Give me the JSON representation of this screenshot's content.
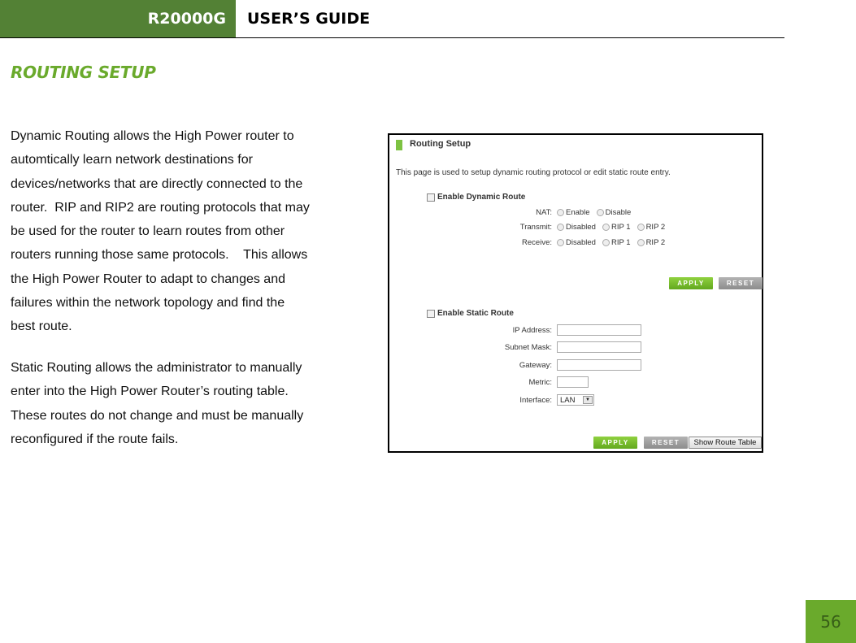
{
  "header": {
    "model": "R20000G",
    "guide": "USER’S GUIDE"
  },
  "section_title": "ROUTING SETUP",
  "paragraphs": {
    "dynamic": "Dynamic Routing allows the High Power router to\nautomtically learn network destinations for\ndevices/networks that are directly connected to the\nrouter.  RIP and RIP2 are routing protocols that may\nbe used for the router to learn routes from other\nrouters running those same protocols.    This allows\nthe High Power Router to adapt to changes and\nfailures within the network topology and find the\nbest route.",
    "static": "Static Routing allows the administrator to manually\nenter into the High Power Router’s routing table.\nThese routes do not change and must be manually\nreconfigured if the route fails."
  },
  "screenshot": {
    "title": "Routing Setup",
    "description": "This page is used to setup dynamic routing protocol or edit static route entry.",
    "dynamic": {
      "checkbox_label": "Enable Dynamic Route",
      "checked": false,
      "nat": {
        "label": "NAT:",
        "options": [
          "Enable",
          "Disable"
        ]
      },
      "transmit": {
        "label": "Transmit:",
        "options": [
          "Disabled",
          "RIP 1",
          "RIP 2"
        ]
      },
      "receive": {
        "label": "Receive:",
        "options": [
          "Disabled",
          "RIP 1",
          "RIP 2"
        ]
      },
      "apply_label": "APPLY",
      "reset_label": "RESET"
    },
    "static": {
      "checkbox_label": "Enable Static Route",
      "checked": false,
      "ip_label": "IP Address:",
      "ip_value": "",
      "mask_label": "Subnet Mask:",
      "mask_value": "",
      "gateway_label": "Gateway:",
      "gateway_value": "",
      "metric_label": "Metric:",
      "metric_value": "",
      "interface_label": "Interface:",
      "interface_value": "LAN",
      "apply_label": "APPLY",
      "reset_label": "RESET",
      "show_table_label": "Show Route Table"
    }
  },
  "page_number": "56",
  "colors": {
    "header_green": "#538135",
    "title_green": "#6aaa2c",
    "accent_green": "#7dc242"
  }
}
